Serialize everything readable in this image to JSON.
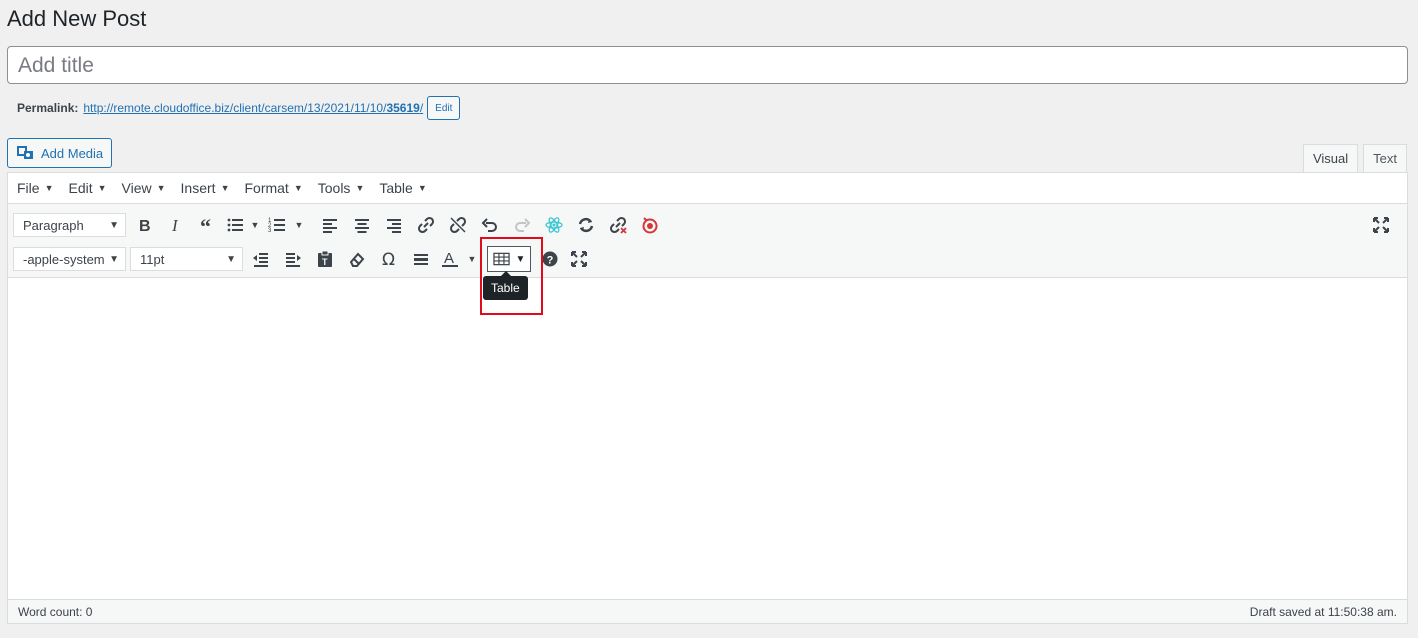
{
  "page": {
    "title": "Add New Post"
  },
  "title_input": {
    "placeholder": "Add title"
  },
  "permalink": {
    "label": "Permalink:",
    "url_base": "http://remote.cloudoffice.biz/client/carsem/13/2021/11/10/",
    "slug": "35619",
    "url_end": "/",
    "edit_label": "Edit"
  },
  "media": {
    "add_label": "Add Media"
  },
  "tabs": [
    {
      "label": "Visual",
      "active": true
    },
    {
      "label": "Text",
      "active": false
    }
  ],
  "menubar": [
    "File",
    "Edit",
    "View",
    "Insert",
    "Format",
    "Tools",
    "Table"
  ],
  "toolbar": {
    "block_format": "Paragraph",
    "font_family": "-apple-system",
    "font_size": "11pt",
    "row1_icons": [
      "bold-icon",
      "italic-icon",
      "blockquote-icon",
      "bullet-list-icon",
      "numbered-list-icon",
      "align-left-icon",
      "align-center-icon",
      "align-right-icon",
      "link-icon",
      "unlink-icon",
      "undo-icon",
      "redo-icon",
      "react-icon",
      "refresh-icon",
      "broken-link-icon",
      "record-icon",
      "fullscreen-icon"
    ],
    "row2_icons": [
      "outdent-icon",
      "indent-icon",
      "paste-text-icon",
      "eraser-icon",
      "omega-icon",
      "horizontal-rule-icon",
      "text-color-icon",
      "table-icon",
      "help-icon",
      "fullscreen-icon"
    ],
    "tooltip": "Table",
    "highlight_color": "#e00b1c"
  },
  "status": {
    "word_count": "Word count: 0",
    "draft_saved": "Draft saved at 11:50:38 am."
  }
}
